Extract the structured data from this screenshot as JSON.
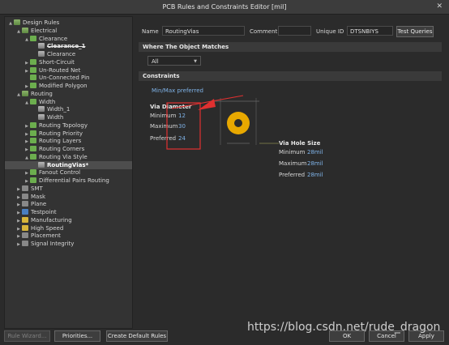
{
  "window": {
    "title": "PCB Rules and Constraints Editor [mil]",
    "close_glyph": "✕"
  },
  "tree": [
    {
      "label": "Design Rules",
      "arrow": "▲",
      "icon": "folder"
    },
    {
      "label": "Electrical",
      "arrow": "▲",
      "icon": "folder"
    },
    {
      "label": "Clearance",
      "arrow": "▲",
      "icon": "green"
    },
    {
      "label": "Clearance_1",
      "arrow": "",
      "icon": "rule"
    },
    {
      "label": "Clearance",
      "arrow": "",
      "icon": "rule"
    },
    {
      "label": "Short-Circuit",
      "arrow": "▶",
      "icon": "green"
    },
    {
      "label": "Un-Routed Net",
      "arrow": "▶",
      "icon": "green"
    },
    {
      "label": "Un-Connected Pin",
      "arrow": "",
      "icon": "green"
    },
    {
      "label": "Modified Polygon",
      "arrow": "▶",
      "icon": "green"
    },
    {
      "label": "Routing",
      "arrow": "▲",
      "icon": "folder"
    },
    {
      "label": "Width",
      "arrow": "▲",
      "icon": "green"
    },
    {
      "label": "Width_1",
      "arrow": "",
      "icon": "rule"
    },
    {
      "label": "Width",
      "arrow": "",
      "icon": "rule"
    },
    {
      "label": "Routing Topology",
      "arrow": "▶",
      "icon": "green"
    },
    {
      "label": "Routing Priority",
      "arrow": "▶",
      "icon": "green"
    },
    {
      "label": "Routing Layers",
      "arrow": "▶",
      "icon": "green"
    },
    {
      "label": "Routing Corners",
      "arrow": "▶",
      "icon": "green"
    },
    {
      "label": "Routing Via Style",
      "arrow": "▲",
      "icon": "green"
    },
    {
      "label": "RoutingVias*",
      "arrow": "",
      "icon": "rule"
    },
    {
      "label": "Fanout Control",
      "arrow": "▶",
      "icon": "green"
    },
    {
      "label": "Differential Pairs Routing",
      "arrow": "▶",
      "icon": "green"
    },
    {
      "label": "SMT",
      "arrow": "▶",
      "icon": "gray"
    },
    {
      "label": "Mask",
      "arrow": "▶",
      "icon": "gray"
    },
    {
      "label": "Plane",
      "arrow": "▶",
      "icon": "gray"
    },
    {
      "label": "Testpoint",
      "arrow": "▶",
      "icon": "blue"
    },
    {
      "label": "Manufacturing",
      "arrow": "▶",
      "icon": "yellow"
    },
    {
      "label": "High Speed",
      "arrow": "▶",
      "icon": "yellow"
    },
    {
      "label": "Placement",
      "arrow": "▶",
      "icon": "gray"
    },
    {
      "label": "Signal Integrity",
      "arrow": "▶",
      "icon": "gray"
    }
  ],
  "rule": {
    "name_label": "Name",
    "name_value": "RoutingVias",
    "comment_label": "Comment",
    "comment_value": "",
    "uid_label": "Unique ID",
    "uid_value": "DTSNBIYS",
    "test_queries": "Test Queries"
  },
  "scope": {
    "header": "Where The Object Matches",
    "selected": "All"
  },
  "constraints": {
    "header": "Constraints",
    "mode_link": "Min/Max preferred",
    "via_diameter": "Via Diameter",
    "min_label": "Minimum",
    "min_value": "12",
    "max_label": "Maximum",
    "max_value": "30",
    "pref_label": "Preferred",
    "pref_value": "24",
    "via_hole": "Via Hole Size",
    "hole_min_label": "Minimum",
    "hole_min_value": "28mil",
    "hole_max_label": "Maximum",
    "hole_max_value": "28mil",
    "hole_pref_label": "Preferred",
    "hole_pref_value": "28mil"
  },
  "buttons": {
    "rule_wizard": "Rule Wizard...",
    "priorities": "Priorities...",
    "create_default": "Create Default Rules",
    "ok": "OK",
    "cancel": "Cancel",
    "apply": "Apply"
  },
  "watermark": "https://blog.csdn.net/rude_dragon",
  "colors": {
    "annotation_red": "#e03030",
    "via_ring": "#e8a800"
  }
}
